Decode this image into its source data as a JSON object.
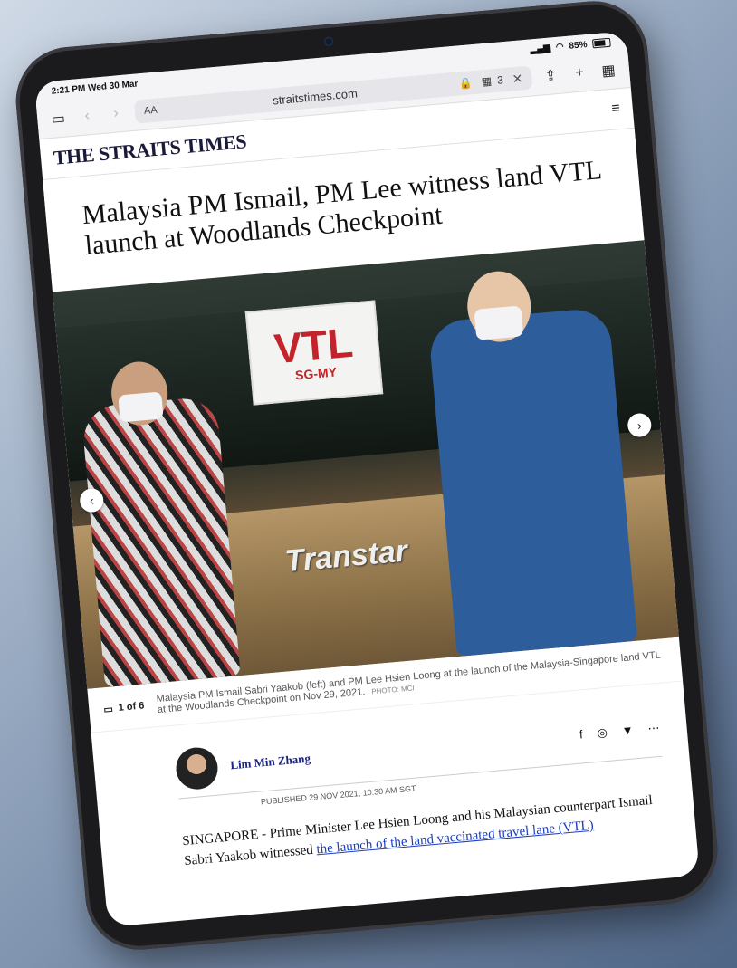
{
  "status": {
    "time": "2:21 PM",
    "date": "Wed 30 Mar",
    "battery": "85%"
  },
  "browser": {
    "text_size_label": "AA",
    "url": "straitstimes.com",
    "tabs_count": "3",
    "close_label": "✕"
  },
  "site": {
    "logo": "THE STRAITS TIMES"
  },
  "article": {
    "headline": "Malaysia PM Ismail, PM Lee witness land VTL launch at Woodlands Checkpoint",
    "photo": {
      "sign_big": "VTL",
      "sign_small": "SG-MY",
      "bus_brand": "Transtar",
      "counter": "1 of 6",
      "caption": "Malaysia PM Ismail Sabri Yaakob (left) and PM Lee Hsien Loong at the launch of the Malaysia-Singapore land VTL at the Woodlands Checkpoint on Nov 29, 2021.",
      "credit": "PHOTO: MCI"
    },
    "author": "Lim Min Zhang",
    "published": "PUBLISHED 29 NOV 2021, 10:30 AM SGT",
    "body_intro": "SINGAPORE - Prime Minister Lee Hsien Loong and his Malaysian counterpart Ismail Sabri Yaakob witnessed",
    "body_link": "the launch of the land vaccinated travel lane (VTL)"
  }
}
